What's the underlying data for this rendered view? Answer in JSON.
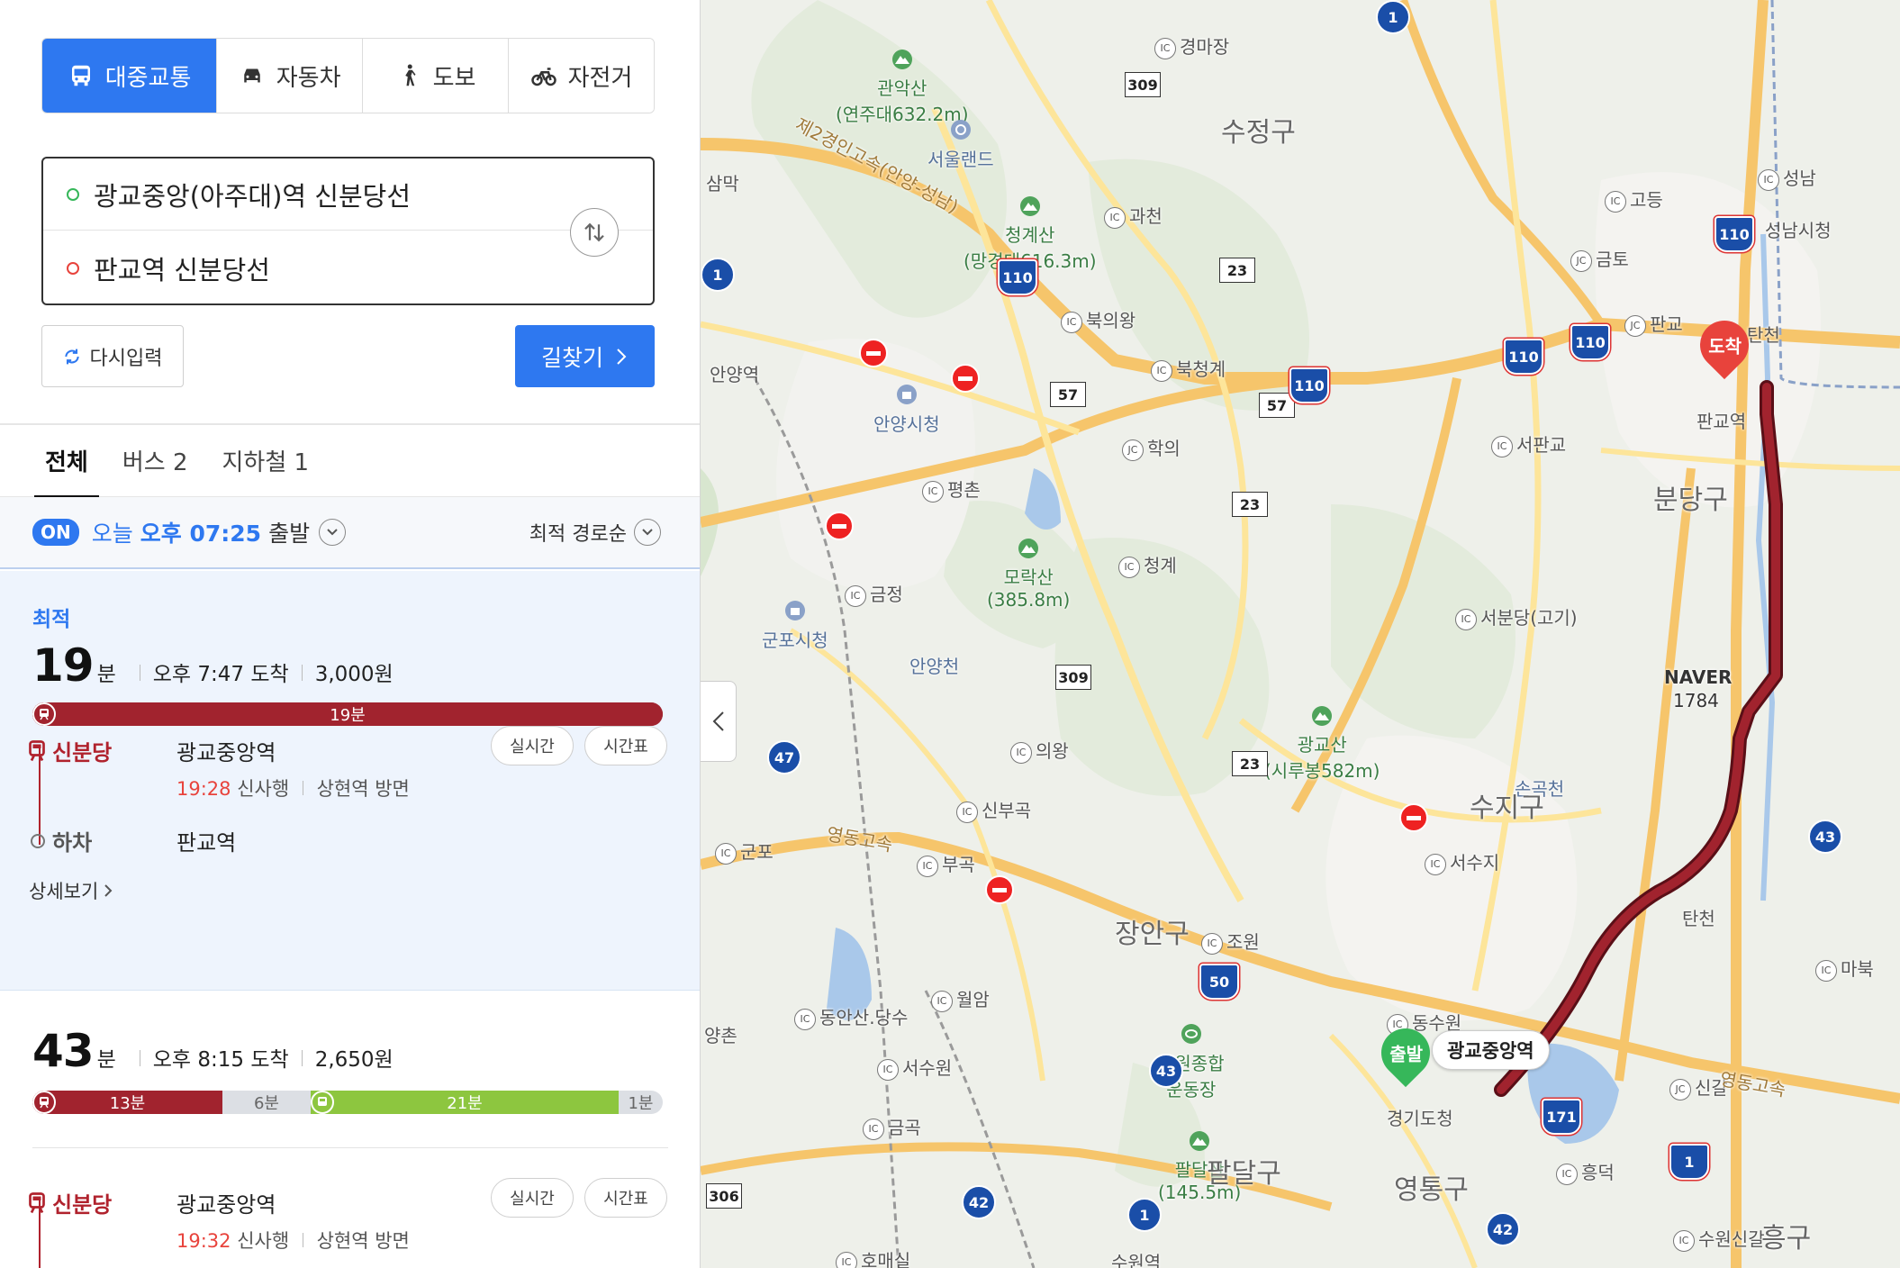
{
  "modes": [
    {
      "label": "대중교통",
      "icon": "bus-icon",
      "active": true
    },
    {
      "label": "자동차",
      "icon": "car-icon",
      "active": false
    },
    {
      "label": "도보",
      "icon": "walk-icon",
      "active": false
    },
    {
      "label": "자전거",
      "icon": "bike-icon",
      "active": false
    }
  ],
  "inputs": {
    "origin": "광교중앙(아주대)역 신분당선",
    "destination": "판교역 신분당선"
  },
  "buttons": {
    "reset": "다시입력",
    "search": "길찾기"
  },
  "tabs": [
    {
      "label": "전체",
      "active": true
    },
    {
      "label": "버스 2",
      "active": false
    },
    {
      "label": "지하철 1",
      "active": false
    }
  ],
  "departure": {
    "on": "ON",
    "today": "오늘",
    "time": "오후 07:25",
    "suffix": "출발",
    "sort": "최적 경로순"
  },
  "routes": [
    {
      "badge": "최적",
      "minutes": "19",
      "unit": "분",
      "arrival": "오후 7:47 도착",
      "fare": "3,000원",
      "bar": [
        {
          "label": "19분",
          "color": "#a1232e",
          "fraction": 1.0
        }
      ],
      "line": "신분당",
      "board_station": "광교중앙역",
      "realtime": "실시간",
      "timetable": "시간표",
      "train_time": "19:28",
      "train_dest": "신사행",
      "train_dir": "상현역 방면",
      "alight_label": "하차",
      "alight_station": "판교역",
      "details": "상세보기"
    },
    {
      "minutes": "43",
      "unit": "분",
      "arrival": "오후 8:15 도착",
      "fare": "2,650원",
      "bar": [
        {
          "label": "13분",
          "color": "#a1232e",
          "fraction": 0.302
        },
        {
          "label": "6분",
          "color": "walk",
          "fraction": 0.14
        },
        {
          "label": "21분",
          "color": "#8dc63f",
          "fraction": 0.488
        },
        {
          "label": "1분",
          "color": "walk",
          "fraction": 0.07
        }
      ],
      "line": "신분당",
      "board_station": "광교중앙역",
      "realtime": "실시간",
      "timetable": "시간표",
      "train_time": "19:32",
      "train_dest": "신사행",
      "train_dir": "상현역 방면"
    }
  ],
  "map": {
    "labels": {
      "gwanaksan": "관악산",
      "gwanaksan_sub": "(연주대632.2m)",
      "seoulland": "서울랜드",
      "cheonggyesan": "청계산",
      "cheonggyesan_sub": "(망경대616.3m)",
      "sujeong": "수정구",
      "seongnam_hall": "성남시청",
      "seongnam": "성남",
      "gyeongmajang": "경마장",
      "gwacheon": "과천",
      "bukuiwang": "북의왕",
      "bukcheonggye": "북청계",
      "hagui": "학의",
      "pyeongchon": "평촌",
      "anyang_hall": "안양시청",
      "anyang_st": "안양역",
      "sammak": "삼막",
      "gyeongin2": "제2경인고속(안양-성남)",
      "godeung": "고등",
      "geumto": "금토",
      "pangyo_jc": "판교",
      "seopangyo": "서판교",
      "tancheon": "탄천",
      "pangyo_st": "판교역",
      "bundang": "분당구",
      "cheonggye": "청계",
      "seobundang": "서분당(고기)",
      "morak": "모락산",
      "morak_sub": "(385.8m)",
      "geumjeong": "금정",
      "gunpo_hall": "군포시청",
      "anyangcheon": "안양천",
      "naver": "NAVER",
      "naver_sub": "1784",
      "uiwang": "의왕",
      "gwanggyosan": "광교산",
      "gwanggyosan_sub": "(시루봉582m)",
      "songokcheon": "손곡천",
      "suji": "수지구",
      "sinbugok": "신부곡",
      "gunpo": "군포",
      "yeongdong_exp": "영동고속",
      "bugok": "부곡",
      "seosuji": "서수지",
      "jangan": "장안구",
      "jowon": "조원",
      "tancheon2": "탄천",
      "mabuk": "마북",
      "dongsuwon": "동수원",
      "uiwang_ansan": "동안산.당수",
      "worram": "월암",
      "suwon_stadium": "수원종합",
      "suwon_stadium2": "운동장",
      "yangchon": "양촌",
      "seosuwon": "서수원",
      "gwanggyo_st": "광교중앙역",
      "gyeonggi_office": "경기도청",
      "singal": "신갈",
      "yeongdong2": "영동고속",
      "geumgok": "금곡",
      "paldalsan": "팔달산",
      "paldalsan_sub": "(145.5m)",
      "paldal": "팔달구",
      "yeongtong": "영통구",
      "heungdeok": "흥덕",
      "suwonsingal": "수원신갈",
      "giheung": "흥구",
      "homaesil": "호매실",
      "suwon_st": "수원역",
      "start": "출발",
      "end": "도착"
    },
    "route_color": "#a1232e"
  }
}
